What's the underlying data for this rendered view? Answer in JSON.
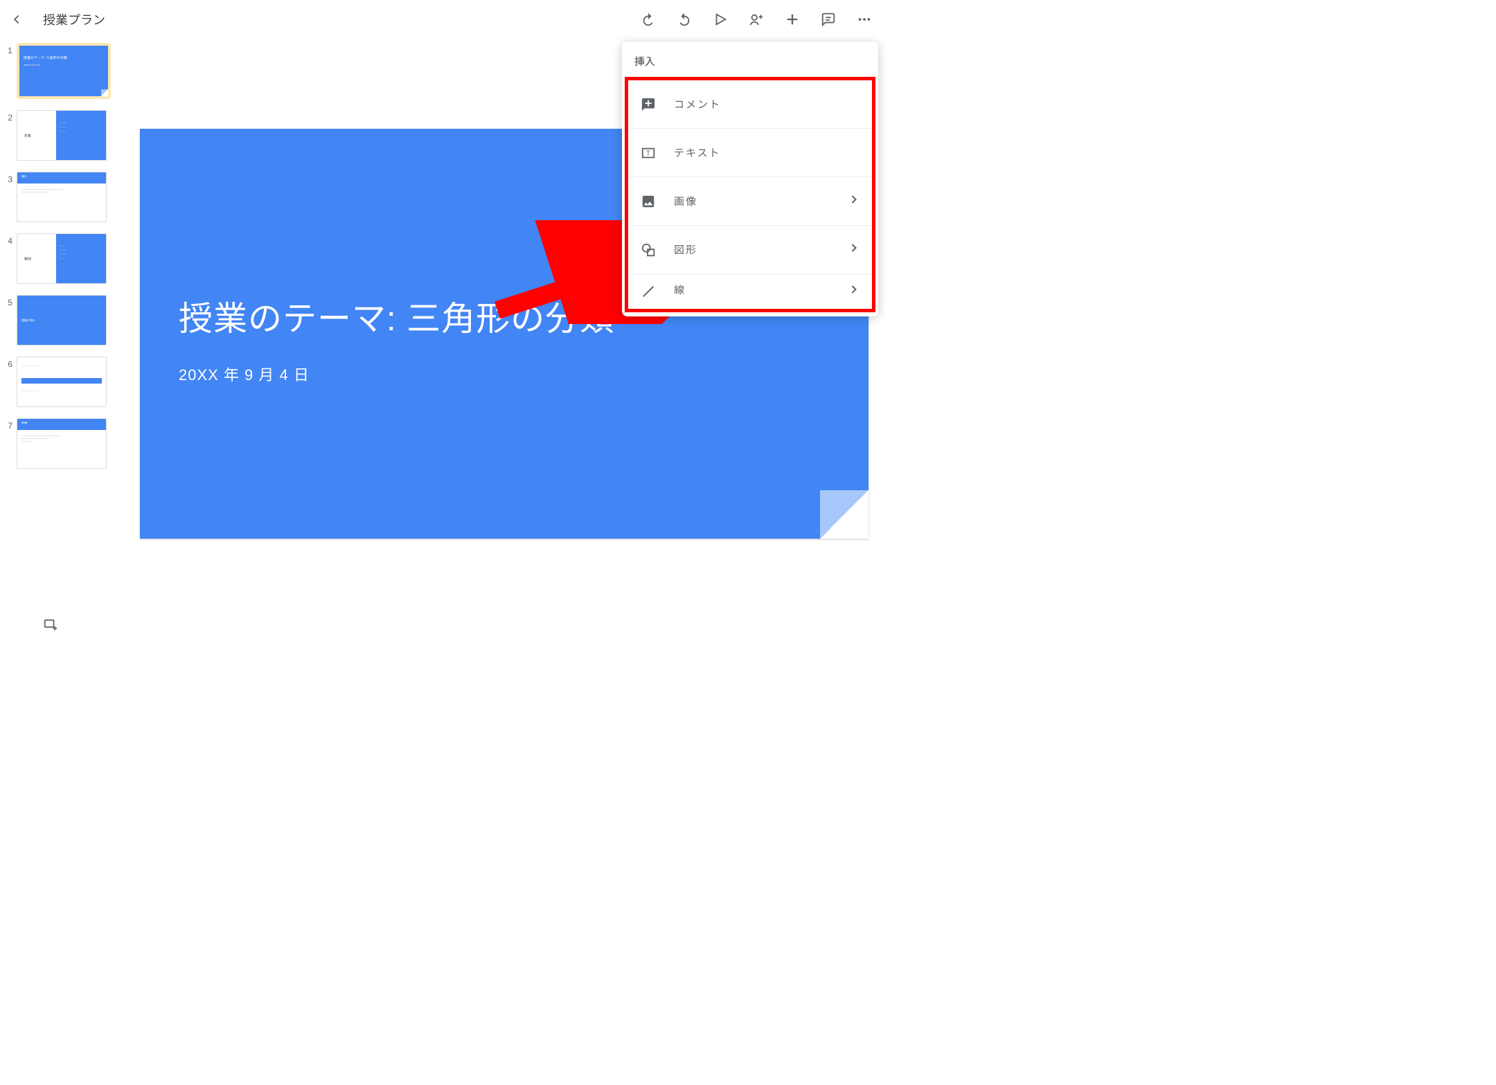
{
  "header": {
    "title": "授業プラン"
  },
  "slide": {
    "title": "授業のテーマ: 三角形の分類",
    "date": "20XX 年 9 月 4 日"
  },
  "thumbnails": [
    {
      "num": "1",
      "title": "授業のテーマ: 三角形の分類",
      "date": "20XX 年 9 月 4 日"
    },
    {
      "num": "2",
      "label": "対象"
    },
    {
      "num": "3",
      "band": "概れ"
    },
    {
      "num": "4",
      "label": "教材"
    },
    {
      "num": "5",
      "band": "授業の流れ"
    },
    {
      "num": "6"
    },
    {
      "num": "7",
      "band": "評価"
    }
  ],
  "menu": {
    "title": "挿入",
    "items": [
      {
        "label": "コメント",
        "icon": "comment-plus",
        "chevron": false
      },
      {
        "label": "テキスト",
        "icon": "text-box",
        "chevron": false
      },
      {
        "label": "画像",
        "icon": "image",
        "chevron": true
      },
      {
        "label": "図形",
        "icon": "shapes",
        "chevron": true
      },
      {
        "label": "線",
        "icon": "line",
        "chevron": true
      }
    ]
  }
}
